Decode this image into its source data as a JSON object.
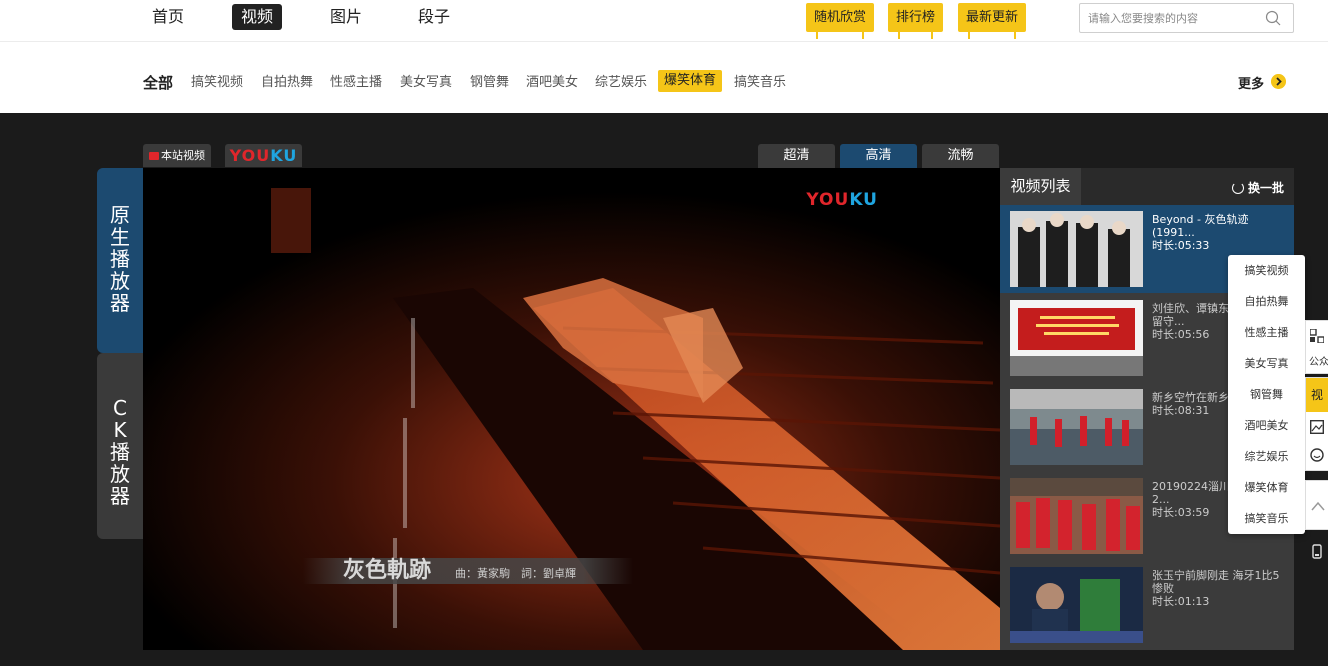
{
  "nav": {
    "items": [
      "首页",
      "视频",
      "图片",
      "段子"
    ],
    "active": "视频",
    "buttons": [
      "随机欣赏",
      "排行榜",
      "最新更新"
    ],
    "search_placeholder": "请输入您要搜索的内容"
  },
  "categories": {
    "all": "全部",
    "items": [
      "搞笑视频",
      "自拍热舞",
      "性感主播",
      "美女写真",
      "钢管舞",
      "酒吧美女",
      "综艺娱乐",
      "爆笑体育",
      "搞笑音乐"
    ],
    "active": "爆笑体育",
    "more": "更多"
  },
  "player": {
    "source_tabs": [
      "本站视频",
      "YOUKU"
    ],
    "quality_tabs": [
      "超清",
      "高清",
      "流畅"
    ],
    "active_quality": "高清",
    "players": [
      "原生播放器",
      "CK播放器"
    ],
    "active_player": "原生播放器",
    "watermark": "YOUKU",
    "subtitle_title": "灰色軌跡",
    "subtitle_credits": "曲：黃家駒　詞：劉卓輝"
  },
  "playlist": {
    "title": "视频列表",
    "refresh": "换一批",
    "items": [
      {
        "title": "Beyond - 灰色轨迹 (1991...",
        "duration": "时长:05:33",
        "active": true
      },
      {
        "title": "刘佳欣、谭镇东...暖、关爱留守...",
        "duration": "时长:05:56"
      },
      {
        "title": "新乡空竹在新乡...演",
        "duration": "时长:08:31"
      },
      {
        "title": "20190224淄川...健走队2...",
        "duration": "时长:03:59"
      },
      {
        "title": "张玉宁前脚刚走 海牙1比5惨败",
        "duration": "时长:01:13"
      }
    ]
  },
  "dropdown": {
    "items": [
      "搞笑视频",
      "自拍热舞",
      "性感主播",
      "美女写真",
      "钢管舞",
      "酒吧美女",
      "综艺娱乐",
      "爆笑体育",
      "搞笑音乐"
    ]
  },
  "floatbar": {
    "qr_label": "公众",
    "video_label": "视"
  },
  "colors": {
    "accent_yellow": "#f5c518",
    "accent_blue": "#1c4a70",
    "stage_bg": "#1b1b1b"
  }
}
